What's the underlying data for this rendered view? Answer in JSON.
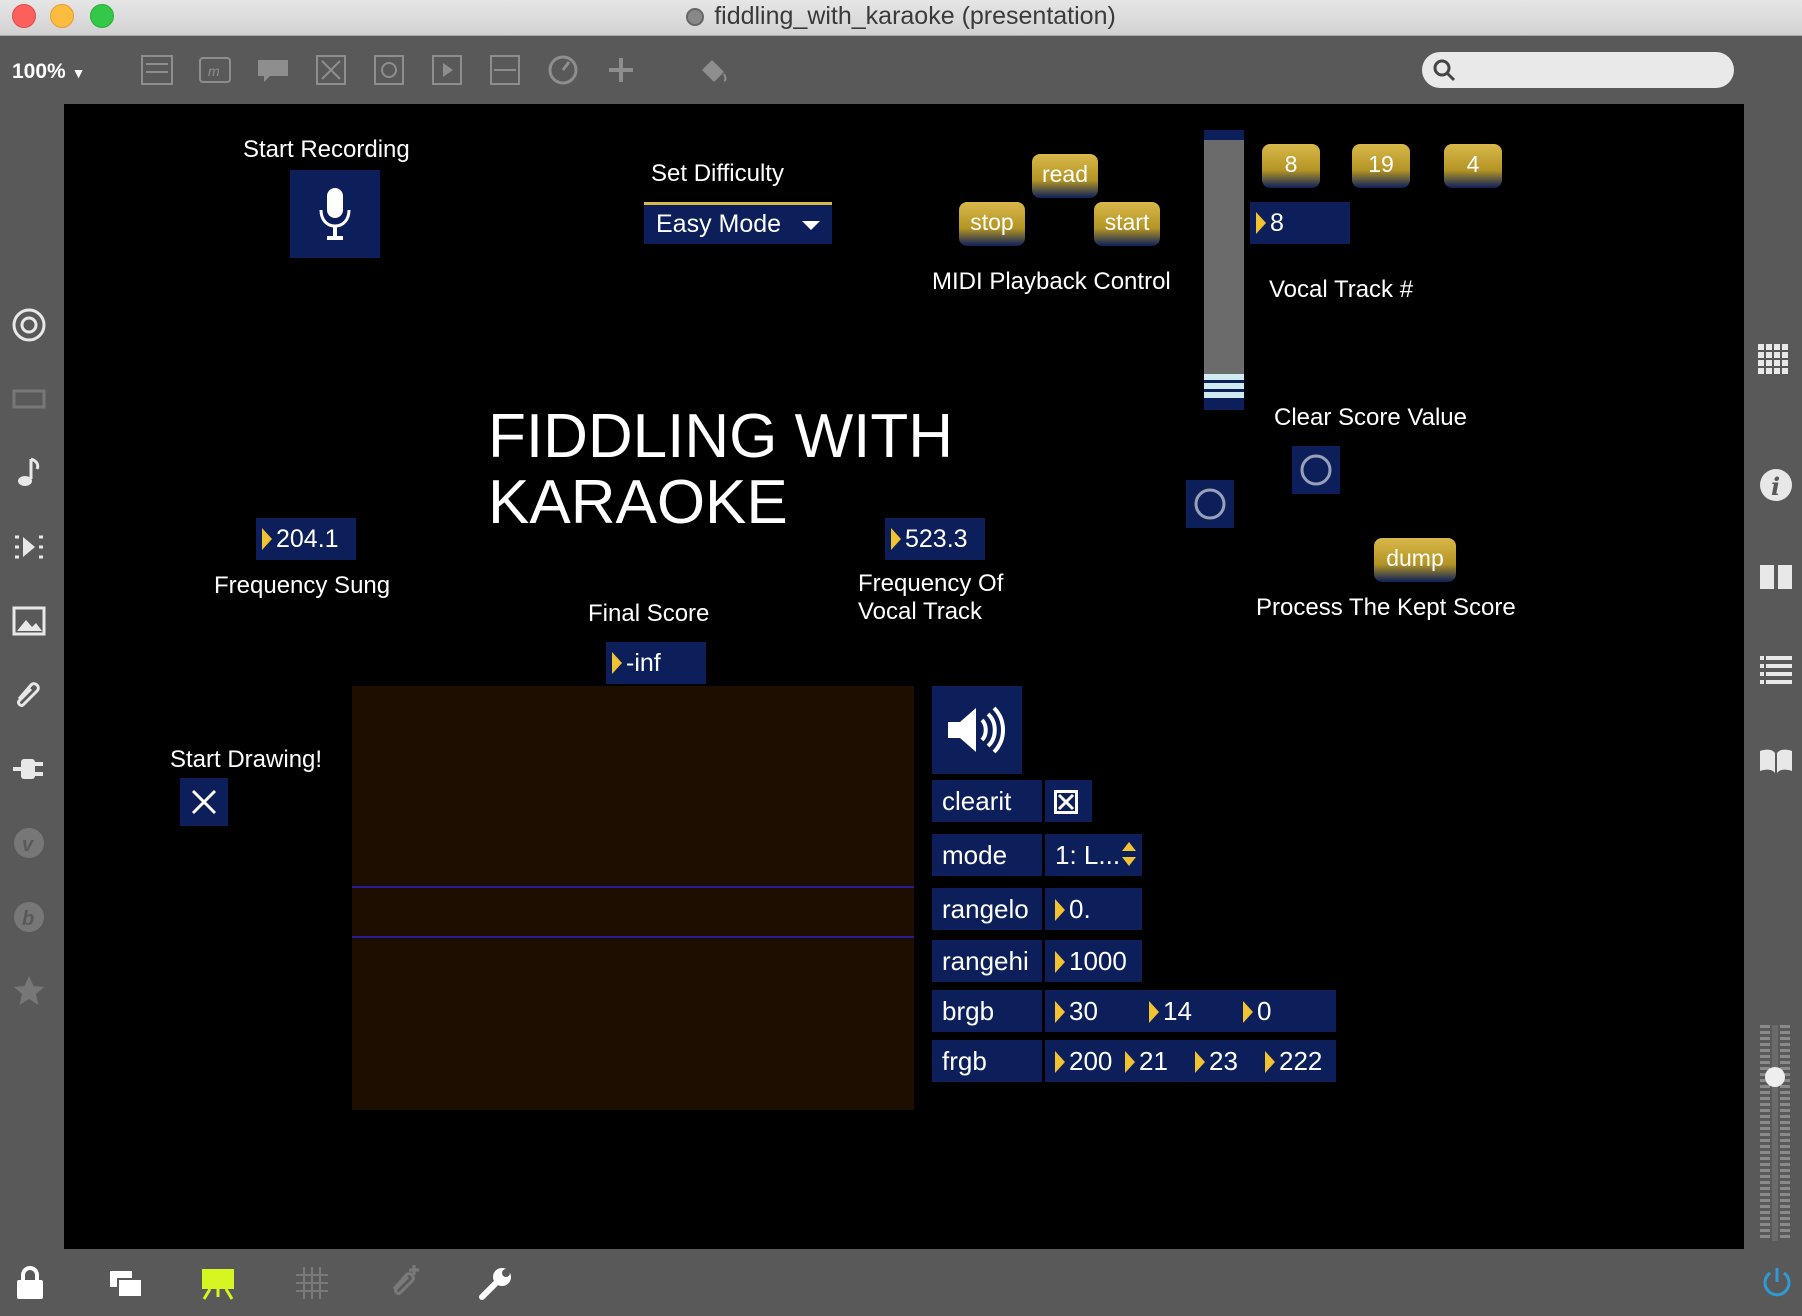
{
  "window": {
    "title": "fiddling_with_karaoke (presentation)"
  },
  "toolbar": {
    "zoom": "100%",
    "tools": [
      "list-icon",
      "message-icon",
      "comment-icon",
      "toggle-icon",
      "button-icon",
      "panel-icon",
      "slider-icon",
      "dial-icon",
      "plus-icon",
      "paint-icon"
    ]
  },
  "left_sidebar": {
    "icons": [
      "target-icon",
      "ticket-icon",
      "music-note-icon",
      "media-icon",
      "image-icon",
      "clip-icon",
      "plug-icon",
      "v-icon",
      "b-icon",
      "star-icon"
    ]
  },
  "right_sidebar": {
    "icons": [
      "grid-icon",
      "info-icon",
      "book-icon",
      "list-icon",
      "reference-icon"
    ]
  },
  "patch": {
    "start_recording": "Start Recording",
    "set_difficulty": "Set Difficulty",
    "difficulty_value": "Easy Mode",
    "read": "read",
    "stop": "stop",
    "start": "start",
    "midi_playback": "MIDI Playback Control",
    "track_buttons": [
      "8",
      "19",
      "4"
    ],
    "vocal_track_value": "8",
    "vocal_track_label": "Vocal Track #",
    "clear_score": "Clear Score Value",
    "title_line1": "FIDDLING WITH",
    "title_line2": "KARAOKE",
    "freq_sung_value": "204.1",
    "freq_sung_label": "Frequency Sung",
    "freq_vocal_value": "523.3",
    "freq_vocal_label_1": "Frequency Of",
    "freq_vocal_label_2": "Vocal Track",
    "dump": "dump",
    "process_kept": "Process The Kept Score",
    "final_score_label": "Final Score",
    "final_score_value": "-inf",
    "start_drawing": "Start Drawing!",
    "slider_level": 0.07
  },
  "inspector": {
    "clearit": "clearit",
    "mode": "mode",
    "mode_value": "1: L...",
    "rangelo": "rangelo",
    "rangelo_value": "0.",
    "rangehi": "rangehi",
    "rangehi_value": "1000",
    "brgb": "brgb",
    "brgb_values": [
      "30",
      "14",
      "0"
    ],
    "frgb": "frgb",
    "frgb_values": [
      "200",
      "21",
      "23",
      "222"
    ]
  },
  "colors": {
    "canvas": "#000000",
    "box": "#0c1f5a",
    "accent": "#f1c232",
    "plot_bg": "#1e0e00",
    "plot_line": "#2a1a9a"
  }
}
